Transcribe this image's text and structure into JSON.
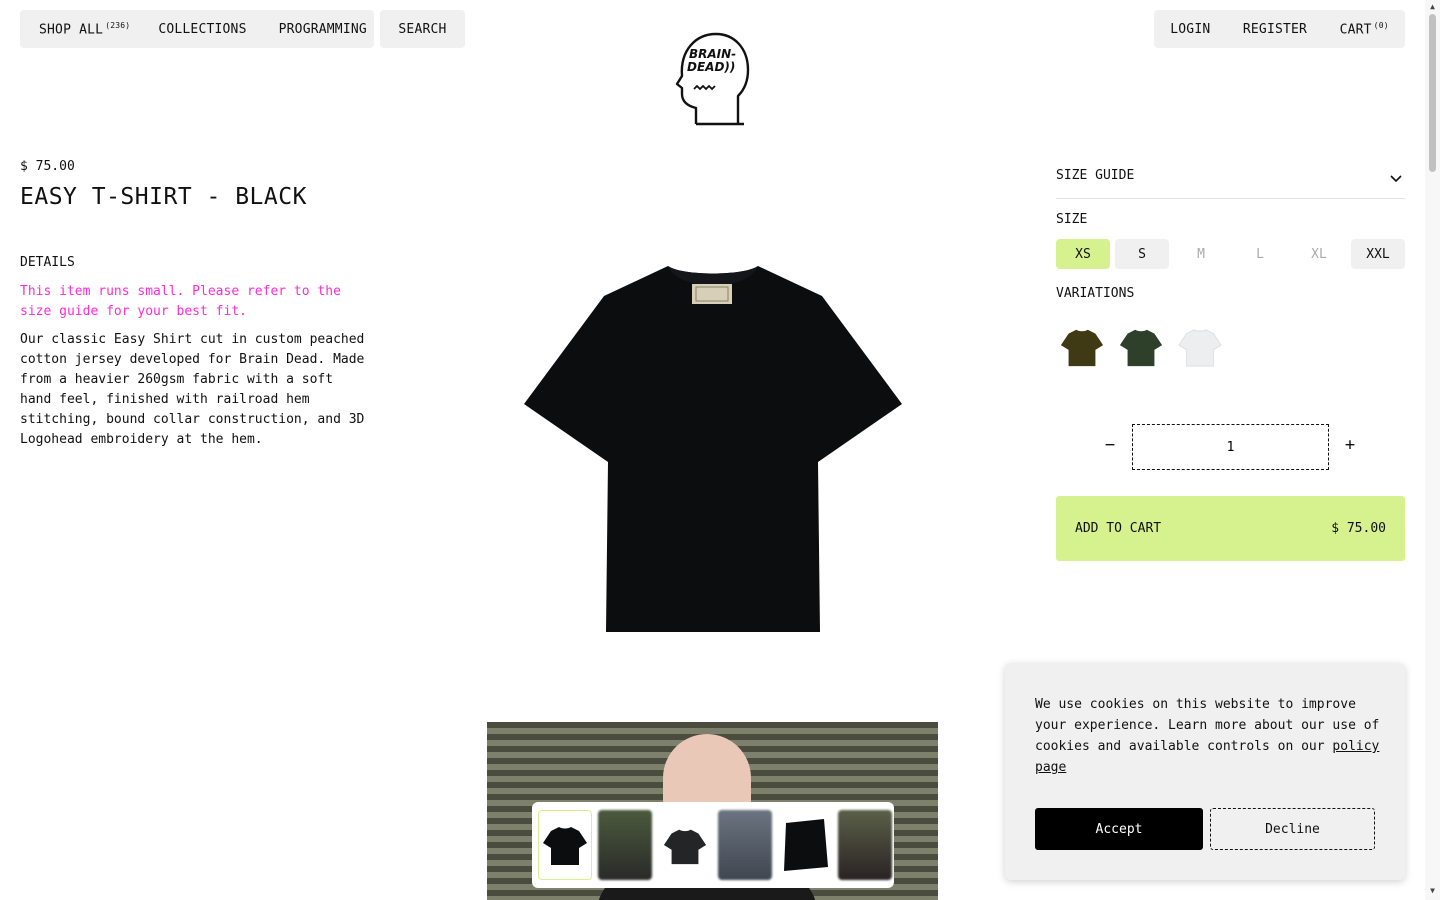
{
  "nav": {
    "shop_all": "SHOP ALL",
    "shop_all_count": "(236)",
    "collections": "COLLECTIONS",
    "programming": "PROGRAMMING",
    "search": "SEARCH",
    "login": "LOGIN",
    "register": "REGISTER",
    "cart": "CART",
    "cart_count": "(0)"
  },
  "logo": {
    "icon": "brain-dead-logohead",
    "line1": "BRAIN-",
    "line2": "DEAD))"
  },
  "product": {
    "price": "$ 75.00",
    "title": "EASY T-SHIRT - BLACK",
    "details_heading": "DETAILS",
    "fit_notice": "This item runs small. Please refer to the size guide for your best fit.",
    "description": "Our classic Easy Shirt cut in custom peached cotton jersey developed for Brain Dead. Made from a heavier 260gsm fabric with a soft hand feel, finished with railroad hem stitching, bound collar construction, and 3D Logohead embroidery at the hem."
  },
  "options": {
    "size_guide": "SIZE GUIDE",
    "size_heading": "SIZE",
    "sizes": [
      {
        "label": "XS",
        "state": "selected"
      },
      {
        "label": "S",
        "state": "available"
      },
      {
        "label": "M",
        "state": "unavailable"
      },
      {
        "label": "L",
        "state": "unavailable"
      },
      {
        "label": "XL",
        "state": "unavailable"
      },
      {
        "label": "XXL",
        "state": "available"
      }
    ],
    "variations_heading": "VARIATIONS",
    "variations": [
      {
        "color": "#3f3a14"
      },
      {
        "color": "#2e3f2a"
      },
      {
        "color": "#eceef0"
      }
    ]
  },
  "quantity": {
    "value": "1",
    "minus": "−",
    "plus": "+"
  },
  "cart_button": {
    "label": "ADD TO CART",
    "price": "$ 75.00"
  },
  "cookie": {
    "text": "We use cookies on this website to improve your experience. Learn more about our use of cookies and available controls on our ",
    "link": "policy page",
    "accept": "Accept",
    "decline": "Decline"
  },
  "colors": {
    "accent": "#d6f28f",
    "notice": "#ff2bd6",
    "nav_bg": "#f0f0f0"
  }
}
